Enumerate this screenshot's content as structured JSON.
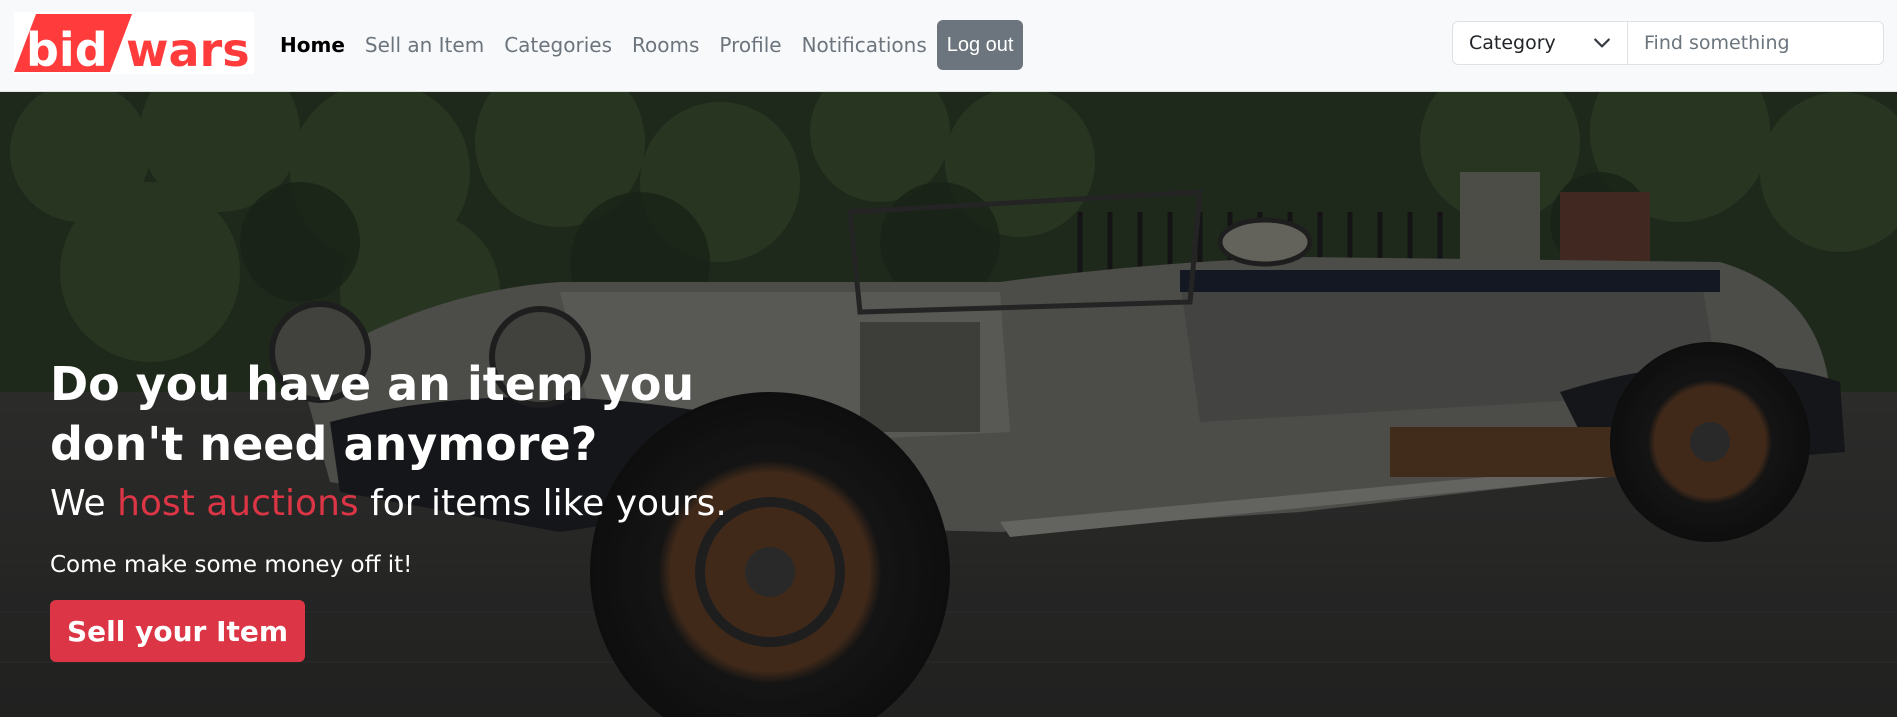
{
  "brand": {
    "logo_text_1": "bid",
    "logo_text_2": "wars.",
    "accent_color": "#ff3030"
  },
  "nav": {
    "items": [
      {
        "label": "Home",
        "active": true
      },
      {
        "label": "Sell an Item",
        "active": false
      },
      {
        "label": "Categories",
        "active": false
      },
      {
        "label": "Rooms",
        "active": false
      },
      {
        "label": "Profile",
        "active": false
      },
      {
        "label": "Notifications",
        "active": false
      }
    ],
    "logout_label": "Log out"
  },
  "search": {
    "category_value": "Category",
    "placeholder": "Find something"
  },
  "hero": {
    "title": "Do you have an item you don't need anymore?",
    "subtitle_pre": "We",
    "subtitle_accent": "host auctions",
    "subtitle_post": "for items like yours.",
    "tagline": "Come make some money off it!",
    "cta_label": "Sell your Item",
    "accent_color": "#dc3545"
  }
}
